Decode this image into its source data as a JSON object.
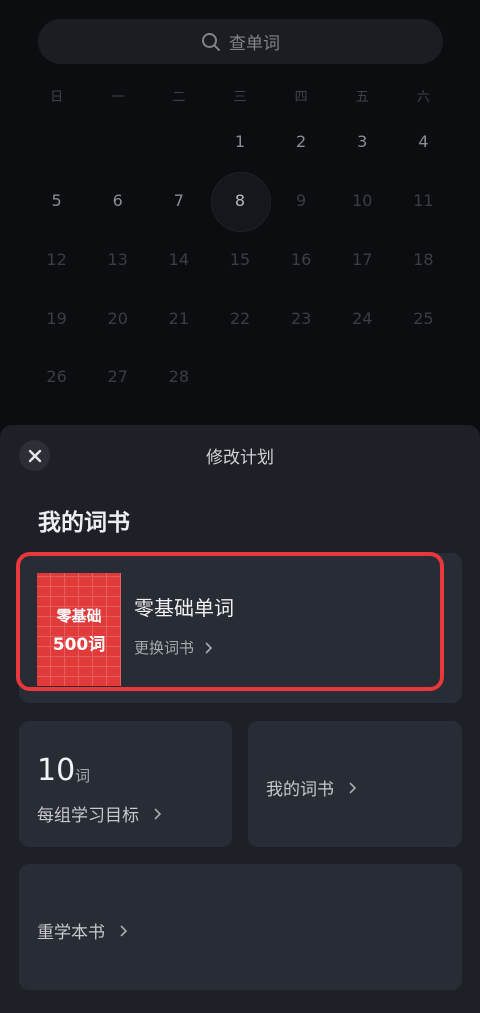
{
  "search": {
    "placeholder": "查单词"
  },
  "calendar": {
    "weekdays": [
      "日",
      "一",
      "二",
      "三",
      "四",
      "五",
      "六"
    ],
    "weeks": [
      [
        "",
        "",
        "",
        "1",
        "2",
        "3",
        "4"
      ],
      [
        "5",
        "6",
        "7",
        "8",
        "9",
        "10",
        "11"
      ],
      [
        "12",
        "13",
        "14",
        "15",
        "16",
        "17",
        "18"
      ],
      [
        "19",
        "20",
        "21",
        "22",
        "23",
        "24",
        "25"
      ],
      [
        "26",
        "27",
        "28",
        "",
        "",
        "",
        ""
      ]
    ],
    "today": "8"
  },
  "sheet": {
    "title": "修改计划",
    "section_title": "我的词书",
    "book": {
      "cover_line1": "零基础",
      "cover_line2": "500词",
      "name": "零基础单词",
      "change_label": "更换词书"
    },
    "goal": {
      "number": "10",
      "unit": "词",
      "label": "每组学习目标"
    },
    "my_books_label": "我的词书",
    "relearn_label": "重学本书"
  },
  "colors": {
    "highlight_border": "#e8383d",
    "cover_red": "#e03a3a",
    "sheet_bg": "#1d2026",
    "card_bg": "#282c34"
  }
}
